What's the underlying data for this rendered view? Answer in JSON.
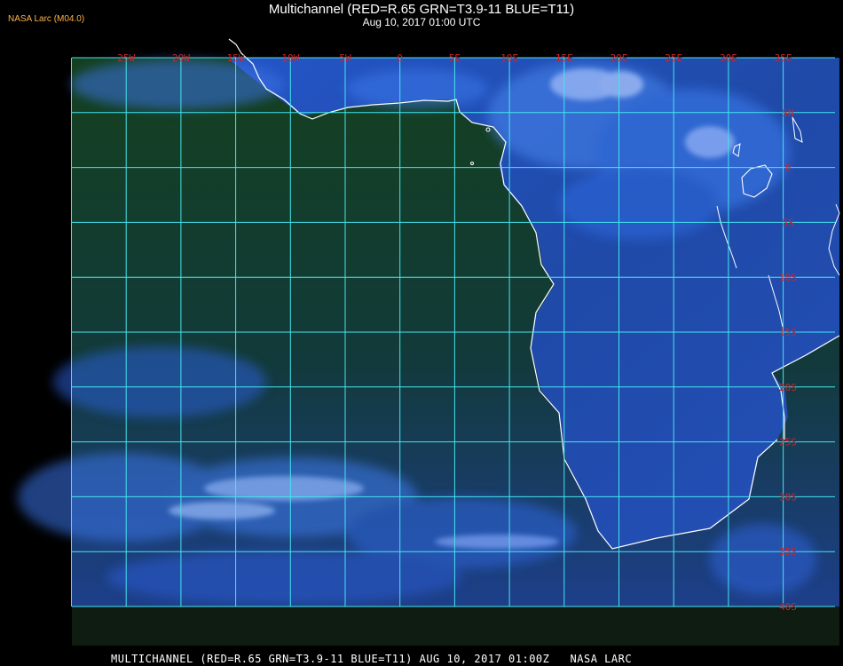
{
  "badge": "NASA Larc (M04.0)",
  "title": "Multichannel (RED=R.65 GRN=T3.9-11 BLUE=T11)",
  "subtitle": "Aug 10, 2017 01:00 UTC",
  "footer": "MULTICHANNEL (RED=R.65 GRN=T3.9-11 BLUE=T11) AUG 10, 2017 01:00Z   NASA LARC",
  "lon_labels": [
    "25W",
    "20W",
    "15W",
    "10W",
    "5W",
    "0",
    "5E",
    "10E",
    "15E",
    "20E",
    "25E",
    "30E",
    "35E"
  ],
  "lat_labels": [
    "5N",
    "0",
    "5S",
    "10S",
    "15S",
    "20S",
    "25S",
    "30S",
    "35S",
    "40S"
  ],
  "colors": {
    "grid": "#44e6ee",
    "coast": "#ffffff",
    "label": "#c8282a",
    "ocean": "#0f3b18",
    "cloud": "#2f6fe0"
  }
}
